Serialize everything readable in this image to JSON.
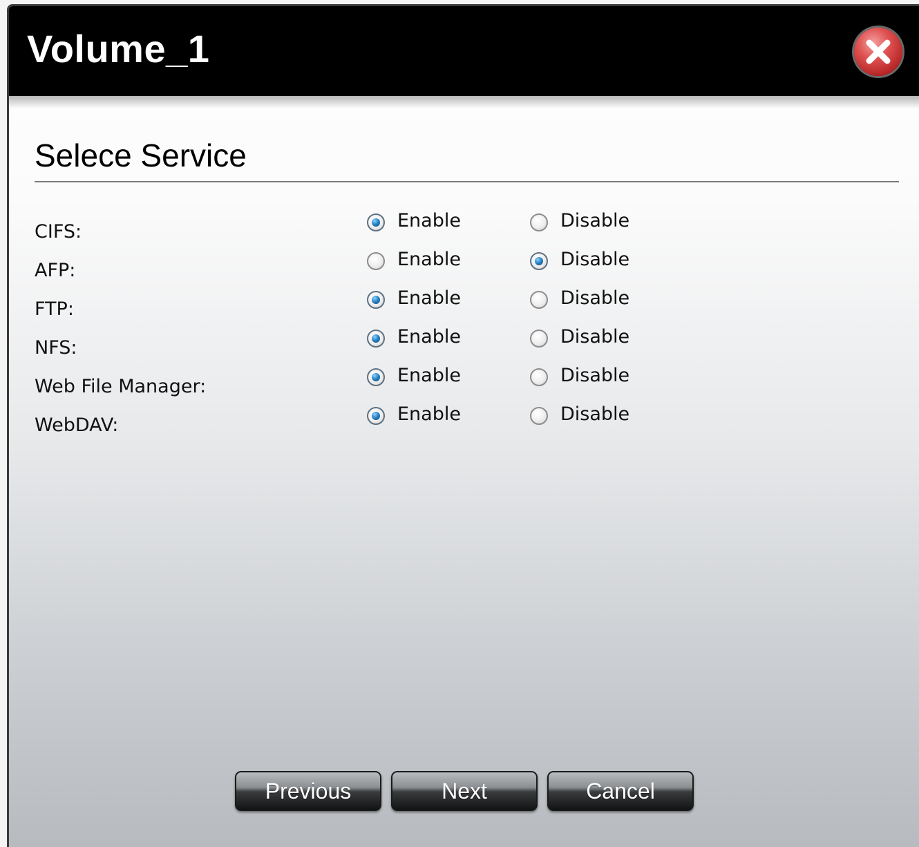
{
  "window": {
    "title": "Volume_1",
    "close_icon": "close-x-icon"
  },
  "section": {
    "title": "Selece Service"
  },
  "services": [
    {
      "label": "CIFS:",
      "enable_label": "Enable",
      "disable_label": "Disable",
      "selected": "enable"
    },
    {
      "label": "AFP:",
      "enable_label": "Enable",
      "disable_label": "Disable",
      "selected": "disable"
    },
    {
      "label": "FTP:",
      "enable_label": "Enable",
      "disable_label": "Disable",
      "selected": "enable"
    },
    {
      "label": "NFS:",
      "enable_label": "Enable",
      "disable_label": "Disable",
      "selected": "enable"
    },
    {
      "label": "Web File Manager:",
      "enable_label": "Enable",
      "disable_label": "Disable",
      "selected": "enable"
    },
    {
      "label": "WebDAV:",
      "enable_label": "Enable",
      "disable_label": "Disable",
      "selected": "enable"
    }
  ],
  "buttons": {
    "previous": "Previous",
    "next": "Next",
    "cancel": "Cancel"
  },
  "colors": {
    "titlebar": "#000000",
    "close_button": "#d23a3a",
    "radio_selected": "#2a86c8"
  }
}
